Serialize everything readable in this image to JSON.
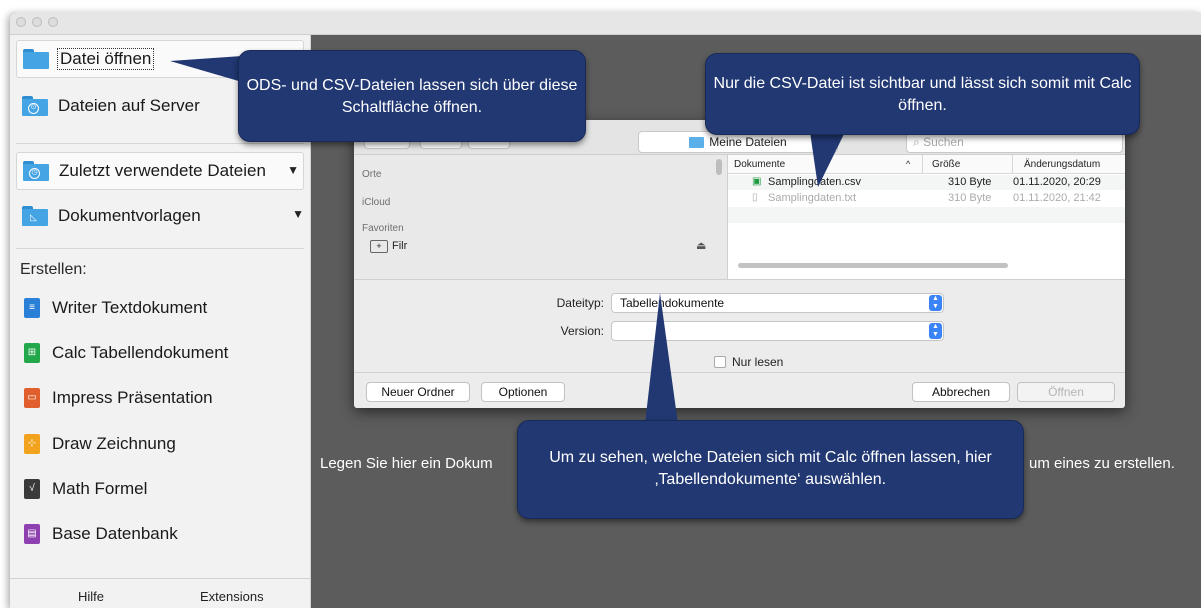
{
  "sidebar": {
    "open_file": "Datei öffnen",
    "remote_files": "Dateien auf Server",
    "recent_files": "Zuletzt verwendete Dateien",
    "templates": "Dokumentvorlagen",
    "create_header": "Erstellen:",
    "apps": [
      {
        "label": "Writer Textdokument",
        "color": "#2a7fd6"
      },
      {
        "label": "Calc Tabellendokument",
        "color": "#22a84a"
      },
      {
        "label": "Impress Präsentation",
        "color": "#e05f2c"
      },
      {
        "label": "Draw Zeichnung",
        "color": "#f1a31d"
      },
      {
        "label": "Math Formel",
        "color": "#3a3a3a"
      },
      {
        "label": "Base Datenbank",
        "color": "#8e3fb0"
      }
    ],
    "footer": {
      "help": "Hilfe",
      "extensions": "Extensions"
    }
  },
  "dialog": {
    "location": "Meine Dateien",
    "search_placeholder": "Suchen",
    "side": {
      "places": "Orte",
      "icloud": "iCloud",
      "favorites": "Favoriten",
      "filr": "Filr"
    },
    "columns": {
      "name": "Dokumente",
      "size": "Größe",
      "date": "Änderungsdatum"
    },
    "files": [
      {
        "name": "Samplingdaten.csv",
        "size": "310 Byte",
        "date": "01.11.2020, 20:29",
        "enabled": true
      },
      {
        "name": "Samplingdaten.txt",
        "size": "310 Byte",
        "date": "01.11.2020, 21:42",
        "enabled": false
      }
    ],
    "filetype_label": "Dateityp:",
    "filetype_value": "Tabellendokumente",
    "version_label": "Version:",
    "version_value": "",
    "readonly_label": "Nur lesen",
    "buttons": {
      "new_folder": "Neuer Ordner",
      "options": "Optionen",
      "cancel": "Abbrechen",
      "open": "Öffnen"
    }
  },
  "background": {
    "hint_left": "Legen Sie hier ein Dokum",
    "hint_right": "um eines zu erstellen."
  },
  "callouts": {
    "open_button": "ODS- und CSV-Dateien lassen sich über diese Schaltfläche öffnen.",
    "csv_visible": "Nur die CSV-Datei ist sichtbar und lässt sich somit mit Calc öffnen.",
    "filetype_hint": "Um zu sehen, welche Dateien sich mit Calc öffnen lassen, hier ‚Tabellendokumente‘ auswählen."
  }
}
